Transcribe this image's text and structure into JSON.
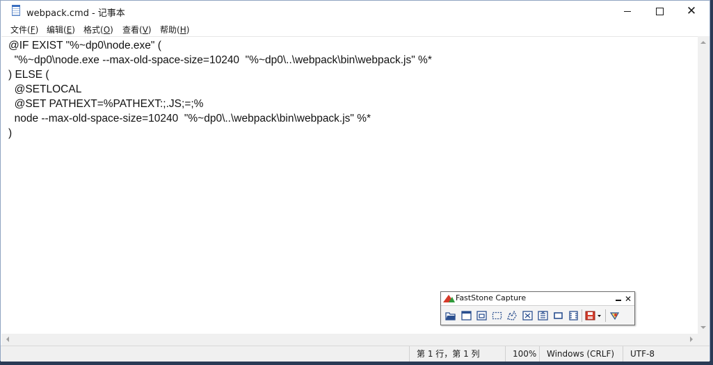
{
  "window": {
    "file_name": "webpack.cmd",
    "separator": "-",
    "app_name": "记事本"
  },
  "menu": [
    {
      "label": "文件(",
      "key": "F",
      "end": ")"
    },
    {
      "label": "编辑(",
      "key": "E",
      "end": ")"
    },
    {
      "label": "格式(",
      "key": "O",
      "end": ")"
    },
    {
      "label": "查看(",
      "key": "V",
      "end": ")"
    },
    {
      "label": "帮助(",
      "key": "H",
      "end": ")"
    }
  ],
  "editor": {
    "lines": [
      "@IF EXIST \"%~dp0\\node.exe\" (",
      "  \"%~dp0\\node.exe --max-old-space-size=10240  \"%~dp0\\..\\webpack\\bin\\webpack.js\" %*",
      ") ELSE (",
      "  @SETLOCAL",
      "  @SET PATHEXT=%PATHEXT:;.JS;=;%",
      "  node --max-old-space-size=10240  \"%~dp0\\..\\webpack\\bin\\webpack.js\" %*",
      ")"
    ]
  },
  "statusbar": {
    "position": "第 1 行，第 1 列",
    "zoom": "100%",
    "line_ending": "Windows (CRLF)",
    "encoding": "UTF-8"
  },
  "faststone": {
    "title": "FastStone Capture",
    "tools": [
      "open-folder-icon",
      "capture-active-window-icon",
      "capture-window-object-icon",
      "capture-rectangle-icon",
      "capture-freehand-icon",
      "capture-fullscreen-icon",
      "capture-scrolling-window-icon",
      "capture-fixed-region-icon",
      "screen-recorder-icon",
      "output-destination-icon",
      "settings-icon"
    ],
    "accent_red": "#d63b2a",
    "accent_green": "#2f9a3b",
    "tool_blue": "#2a4f8f"
  }
}
